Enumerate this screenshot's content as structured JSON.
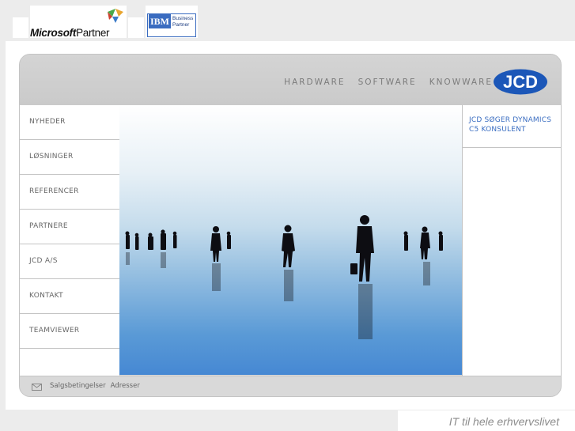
{
  "partners": {
    "microsoft": {
      "brand": "Microsoft",
      "word": "Partner"
    },
    "ibm": {
      "mark": "IBM",
      "line1": "Business",
      "line2": "Partner"
    }
  },
  "header": {
    "nav": [
      "HARDWARE",
      "SOFTWARE",
      "KNOWWARE"
    ],
    "logo": "JCD"
  },
  "sidebar": {
    "items": [
      {
        "label": "NYHEDER"
      },
      {
        "label": "LØSNINGER"
      },
      {
        "label": "REFERENCER"
      },
      {
        "label": "PARTNERE"
      },
      {
        "label": "JCD A/S"
      },
      {
        "label": "KONTAKT"
      },
      {
        "label": "TEAMVIEWER"
      }
    ]
  },
  "news": {
    "headline": "JCD SØGER DYNAMICS C5 KONSULENT"
  },
  "footer": {
    "links": [
      "Salgsbetingelser",
      "Adresser"
    ]
  },
  "tagline": "IT til hele erhvervslivet",
  "colors": {
    "accent": "#3a6dc1",
    "logo_blue": "#1c57b8"
  }
}
